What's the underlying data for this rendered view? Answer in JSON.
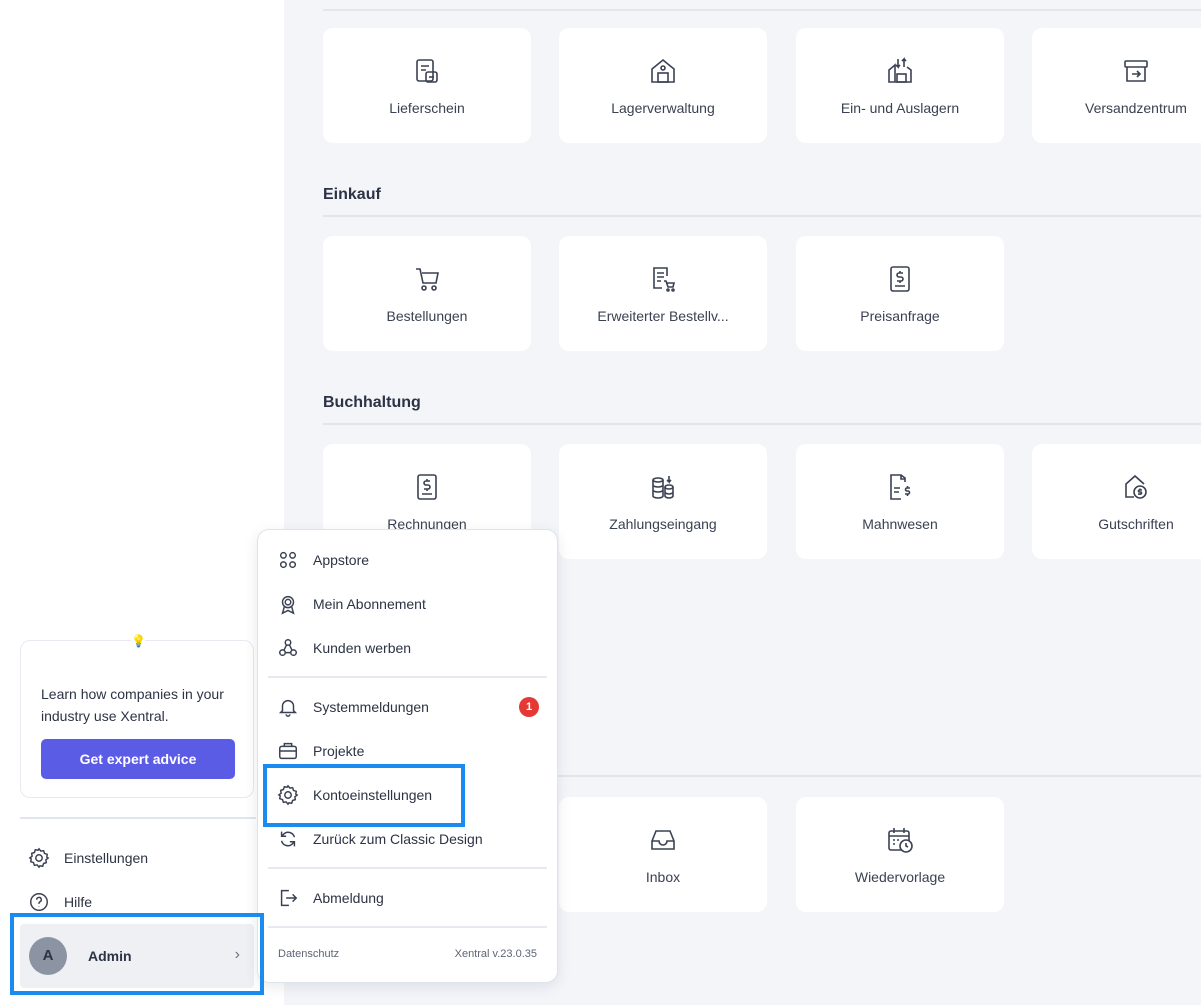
{
  "sections": {
    "einkauf": "Einkauf",
    "buchhaltung": "Buchhaltung"
  },
  "tiles": {
    "row1": [
      {
        "label": "Lieferschein",
        "icon": "delivery-note-icon"
      },
      {
        "label": "Lagerverwaltung",
        "icon": "warehouse-icon"
      },
      {
        "label": "Ein- und Auslagern",
        "icon": "stock-in-out-icon"
      },
      {
        "label": "Versandzentrum",
        "icon": "shipping-box-icon"
      }
    ],
    "einkauf": [
      {
        "label": "Bestellungen",
        "icon": "cart-icon"
      },
      {
        "label": "Erweiterter Bestellv...",
        "icon": "order-doc-cart-icon"
      },
      {
        "label": "Preisanfrage",
        "icon": "price-request-icon"
      }
    ],
    "buchhaltung": [
      {
        "label": "Rechnungen",
        "icon": "invoice-icon"
      },
      {
        "label": "Zahlungseingang",
        "icon": "coins-icon"
      },
      {
        "label": "Mahnwesen",
        "icon": "dunning-doc-icon"
      },
      {
        "label": "Gutschriften",
        "icon": "credit-house-icon"
      }
    ],
    "bottom": [
      {
        "label": "Inbox",
        "icon": "inbox-icon"
      },
      {
        "label": "Wiedervorlage",
        "icon": "calendar-clock-icon"
      }
    ]
  },
  "promo": {
    "text": "Learn how companies in your industry use Xentral.",
    "button": "Get expert advice"
  },
  "sidebar": {
    "settings": "Einstellungen",
    "help": "Hilfe",
    "user_initial": "A",
    "user_name": "Admin",
    "chevron": "›"
  },
  "menu": {
    "items": [
      {
        "label": "Appstore",
        "icon": "apps-grid-icon"
      },
      {
        "label": "Mein Abonnement",
        "icon": "award-icon"
      },
      {
        "label": "Kunden werben",
        "icon": "referral-icon"
      },
      {
        "label": "Systemmeldungen",
        "icon": "bell-icon",
        "badge": "1"
      },
      {
        "label": "Projekte",
        "icon": "folder-box-icon"
      },
      {
        "label": "Kontoeinstellungen",
        "icon": "gear-icon"
      },
      {
        "label": "Zurück zum Classic Design",
        "icon": "refresh-icon"
      },
      {
        "label": "Abmeldung",
        "icon": "logout-icon"
      }
    ],
    "footer_left": "Datenschutz",
    "footer_right": "Xentral v.23.0.35"
  },
  "colors": {
    "accent": "#5b5ce6",
    "highlight": "#1a8cf0",
    "badge": "#e53935",
    "background": "#f3f5f9"
  }
}
